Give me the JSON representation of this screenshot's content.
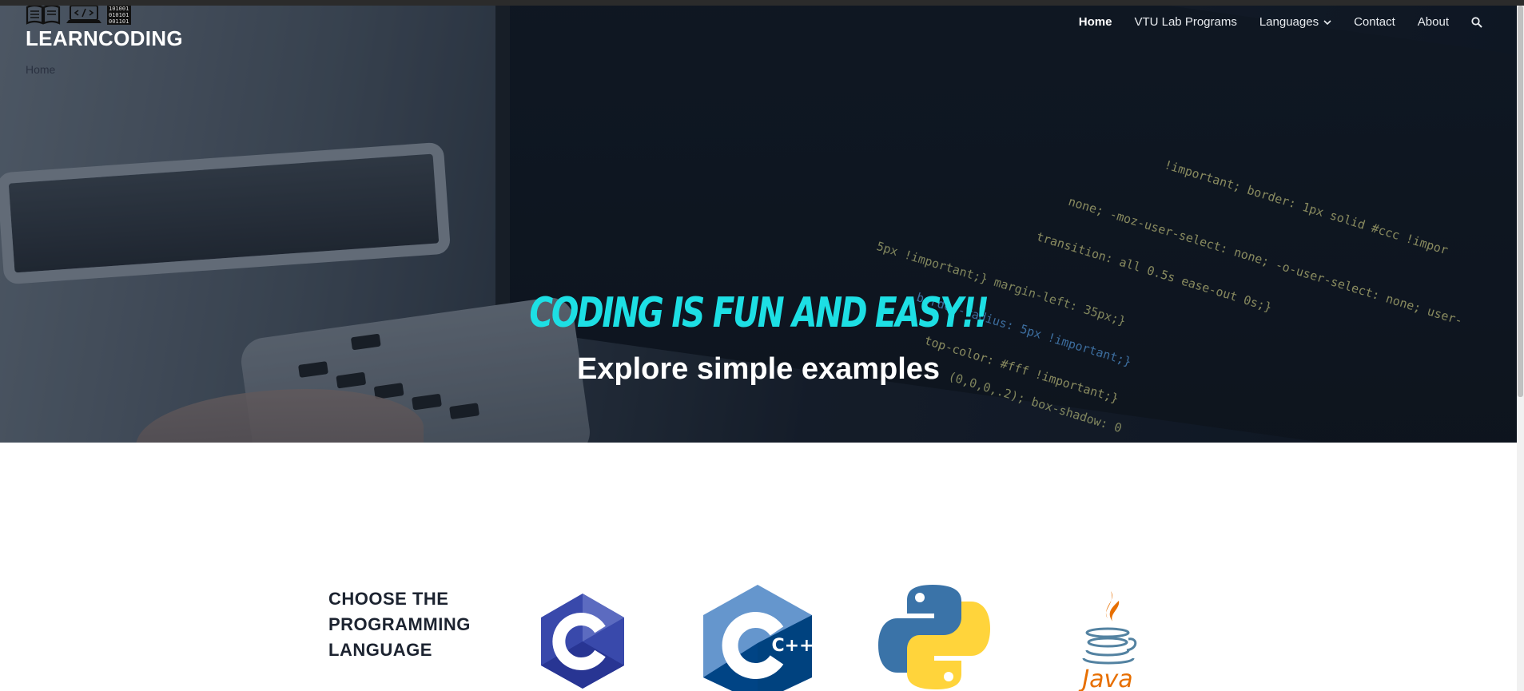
{
  "brand": {
    "title": "LEARNCODING",
    "breadcrumb": "Home"
  },
  "nav": {
    "items": [
      {
        "label": "Home"
      },
      {
        "label": "VTU Lab Programs"
      },
      {
        "label": "Languages"
      },
      {
        "label": "Contact"
      },
      {
        "label": "About"
      }
    ],
    "search_icon": "search-icon",
    "dropdown_icon": "chevron-down-icon"
  },
  "hero": {
    "tagline": "Coding is fun and easy!!",
    "subline": "Explore simple examples",
    "code_lines": [
      "!important; border: 1px solid #ccc !impor",
      "none; -moz-user-select: none; -o-user-select: none; user-",
      "transition: all 0.5s ease-out 0s;}",
      "5px !important;} margin-left: 35px;}",
      "border-radius: 5px !important;}",
      "top-color: #fff !important;}",
      "(0,0,0,.2); box-shadow: 0"
    ],
    "colors": {
      "tagline": "#1ddfe4",
      "code_keyword": "#5fb0ff",
      "code_text": "#e6e28c"
    }
  },
  "languages": {
    "heading": "CHOOSE THE PROGRAMMING LANGUAGE",
    "items": [
      {
        "name": "c-logo",
        "label": "C"
      },
      {
        "name": "cpp-logo",
        "label": "C++"
      },
      {
        "name": "python-logo"
      },
      {
        "name": "java-logo",
        "label": "Java"
      }
    ]
  }
}
